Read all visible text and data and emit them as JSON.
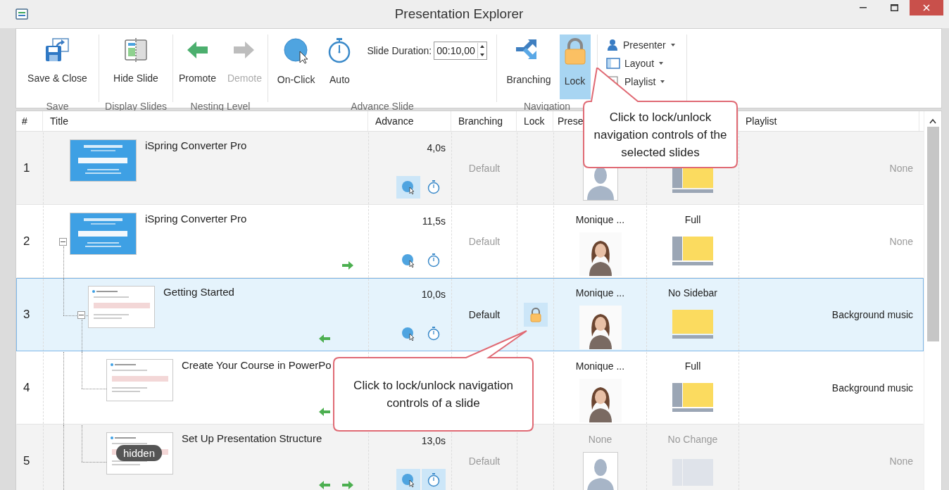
{
  "window": {
    "title": "Presentation Explorer"
  },
  "ribbon": {
    "groups": [
      {
        "label": "Save",
        "items": [
          {
            "kind": "save",
            "label": "Save & Close",
            "selected": false,
            "disabled": false
          }
        ]
      },
      {
        "label": "Display Slides",
        "items": [
          {
            "kind": "hide",
            "label": "Hide Slide",
            "selected": false,
            "disabled": false
          }
        ]
      },
      {
        "label": "Nesting Level",
        "items": [
          {
            "kind": "promote",
            "label": "Promote",
            "selected": false,
            "disabled": false
          },
          {
            "kind": "demote",
            "label": "Demote",
            "selected": false,
            "disabled": true
          }
        ]
      },
      {
        "label": "Advance Slide",
        "items": [
          {
            "kind": "onclick",
            "label": "On-Click",
            "selected": false,
            "disabled": false
          },
          {
            "kind": "auto",
            "label": "Auto",
            "selected": false,
            "disabled": false
          },
          {
            "kind": "duration",
            "label": "Slide Duration:",
            "value": "00:10,00"
          }
        ]
      },
      {
        "label": "Navigation",
        "items": [
          {
            "kind": "branching",
            "label": "Branching",
            "selected": false,
            "disabled": false
          },
          {
            "kind": "lock",
            "label": "Lock",
            "selected": true,
            "disabled": false
          }
        ]
      },
      {
        "items": [
          {
            "kind": "presenter",
            "label": "Presenter",
            "selected": false,
            "disabled": false
          },
          {
            "kind": "layout",
            "label": "Layout",
            "selected": false,
            "disabled": false
          },
          {
            "kind": "playlist",
            "label": "Playlist",
            "selected": false,
            "disabled": false
          }
        ]
      }
    ]
  },
  "table": {
    "columns": [
      {
        "kind": "number",
        "label": "#"
      },
      {
        "kind": "title",
        "label": "Title"
      },
      {
        "kind": "advance",
        "label": "Advance"
      },
      {
        "kind": "branching",
        "label": "Branching"
      },
      {
        "kind": "lock",
        "label": "Lock"
      },
      {
        "kind": "presenter",
        "label": "Prese"
      },
      {
        "kind": "layout"
      },
      {
        "kind": "playlist",
        "label": "Playlist"
      }
    ],
    "rows": [
      {
        "number": "1",
        "title": "iSpring Converter Pro",
        "thumbnail": {
          "kind": "cover"
        },
        "shaded": true,
        "selected": false,
        "advance": "4,0s",
        "on_click": true,
        "auto": false,
        "back_arrow": false,
        "forward_arrow": false,
        "branching": "Default",
        "branching_dimmed": true,
        "locked": false,
        "avatar": {
          "kind": "silhouette"
        },
        "layout_preview": {
          "kind": "sidebar"
        },
        "playlist": "None",
        "playlist_dimmed": true
      },
      {
        "number": "2",
        "title": "iSpring Converter Pro",
        "thumbnail": {
          "kind": "cover"
        },
        "shaded": false,
        "selected": false,
        "expanded": true,
        "advance": "11,5s",
        "on_click": false,
        "auto": false,
        "back_arrow": false,
        "forward_arrow": true,
        "branching": "Default",
        "branching_dimmed": true,
        "locked": false,
        "presenter": "Monique ...",
        "presenter_dimmed": false,
        "avatar": {
          "kind": "photo"
        },
        "layout": "Full",
        "layout_dimmed": false,
        "layout_preview": {
          "kind": "sidebar"
        },
        "playlist": "None",
        "playlist_dimmed": true,
        "children": [
          {
            "number": "3",
            "title": "Getting Started",
            "thumbnail": {
              "kind": "content"
            },
            "selected": true,
            "expanded": true,
            "advance": "10,0s",
            "on_click": false,
            "auto": false,
            "back_arrow": true,
            "forward_arrow": false,
            "branching": "Default",
            "branching_dimmed": false,
            "locked": true,
            "presenter": "Monique ...",
            "presenter_dimmed": false,
            "avatar": {
              "kind": "photo"
            },
            "layout": "No Sidebar",
            "layout_dimmed": false,
            "layout_preview": {
              "kind": "no_sidebar"
            },
            "playlist": "Background music",
            "playlist_dimmed": false,
            "children": [
              {
                "number": "4",
                "title": "Create Your Course in PowerPo",
                "thumbnail": {
                  "kind": "content"
                },
                "shaded": false,
                "selected": false,
                "back_arrow": true,
                "forward_arrow": false,
                "presenter": "Monique ...",
                "presenter_dimmed": false,
                "avatar": {
                  "kind": "photo"
                },
                "layout": "Full",
                "layout_dimmed": false,
                "layout_preview": {
                  "kind": "sidebar"
                },
                "playlist": "Background music",
                "playlist_dimmed": false
              },
              {
                "number": "5",
                "title": "Set Up Presentation Structure",
                "thumbnail": {
                  "kind": "content"
                },
                "badge": "hidden",
                "shaded": true,
                "selected": false,
                "advance": "13,0s",
                "on_click": true,
                "auto": true,
                "back_arrow": true,
                "forward_arrow": true,
                "branching": "Default",
                "branching_dimmed": true,
                "locked": false,
                "presenter": "None",
                "presenter_dimmed": true,
                "avatar": {
                  "kind": "silhouette"
                },
                "layout": "No Change",
                "layout_dimmed": true,
                "layout_preview": {
                  "kind": "no_change"
                },
                "playlist": "None",
                "playlist_dimmed": true
              }
            ]
          }
        ]
      }
    ]
  },
  "callouts": [
    {
      "text": "Click to lock/unlock navigation controls of the selected slides"
    },
    {
      "text": "Click to lock/unlock navigation controls of a slide"
    }
  ]
}
